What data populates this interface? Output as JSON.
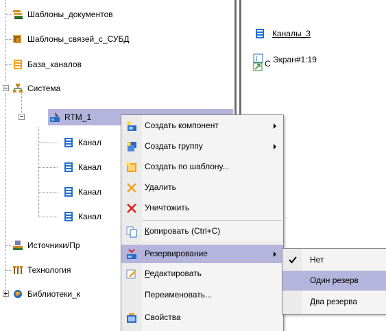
{
  "tree": {
    "items": [
      {
        "label": "Шаблоны_документов"
      },
      {
        "label": "Шаблоны_связей_с_СУБД"
      },
      {
        "label": "База_каналов"
      },
      {
        "label": "Система"
      },
      {
        "label": "RTM_1"
      },
      {
        "label": "Канал"
      },
      {
        "label": "Канал"
      },
      {
        "label": "Канал"
      },
      {
        "label": "Канал"
      },
      {
        "label": "Источники/Пр"
      },
      {
        "label": "Технология"
      },
      {
        "label": "Библиотеки_к"
      }
    ]
  },
  "right_panel": {
    "items": [
      {
        "label": "Каналы_3"
      },
      {
        "label": "Экран#1:19",
        "badge": "C"
      }
    ]
  },
  "context_menu": {
    "items": [
      {
        "label": "Создать компонент",
        "has_submenu": true
      },
      {
        "label": "Создать группу",
        "has_submenu": true
      },
      {
        "label": "Создать по шаблону..."
      },
      {
        "label": "Удалить"
      },
      {
        "label": "Уничтожить"
      },
      {
        "label_hotkey": "К",
        "label_rest": "опировать (Ctrl+C)"
      },
      {
        "label": "Резервирование",
        "has_submenu": true,
        "highlighted": true
      },
      {
        "label_hotkey": "Р",
        "label_rest": "едактировать"
      },
      {
        "label": "Переименовать..."
      },
      {
        "label": "Свойства"
      }
    ]
  },
  "submenu": {
    "items": [
      {
        "label": "Нет",
        "checked": true
      },
      {
        "label": "Один резерв",
        "highlighted": true
      },
      {
        "label": "Два резерва"
      }
    ]
  },
  "colors": {
    "highlight": "#b4b4dc",
    "menu_bg": "#f4f4f4",
    "channel_icon": "#1f6fd0"
  }
}
